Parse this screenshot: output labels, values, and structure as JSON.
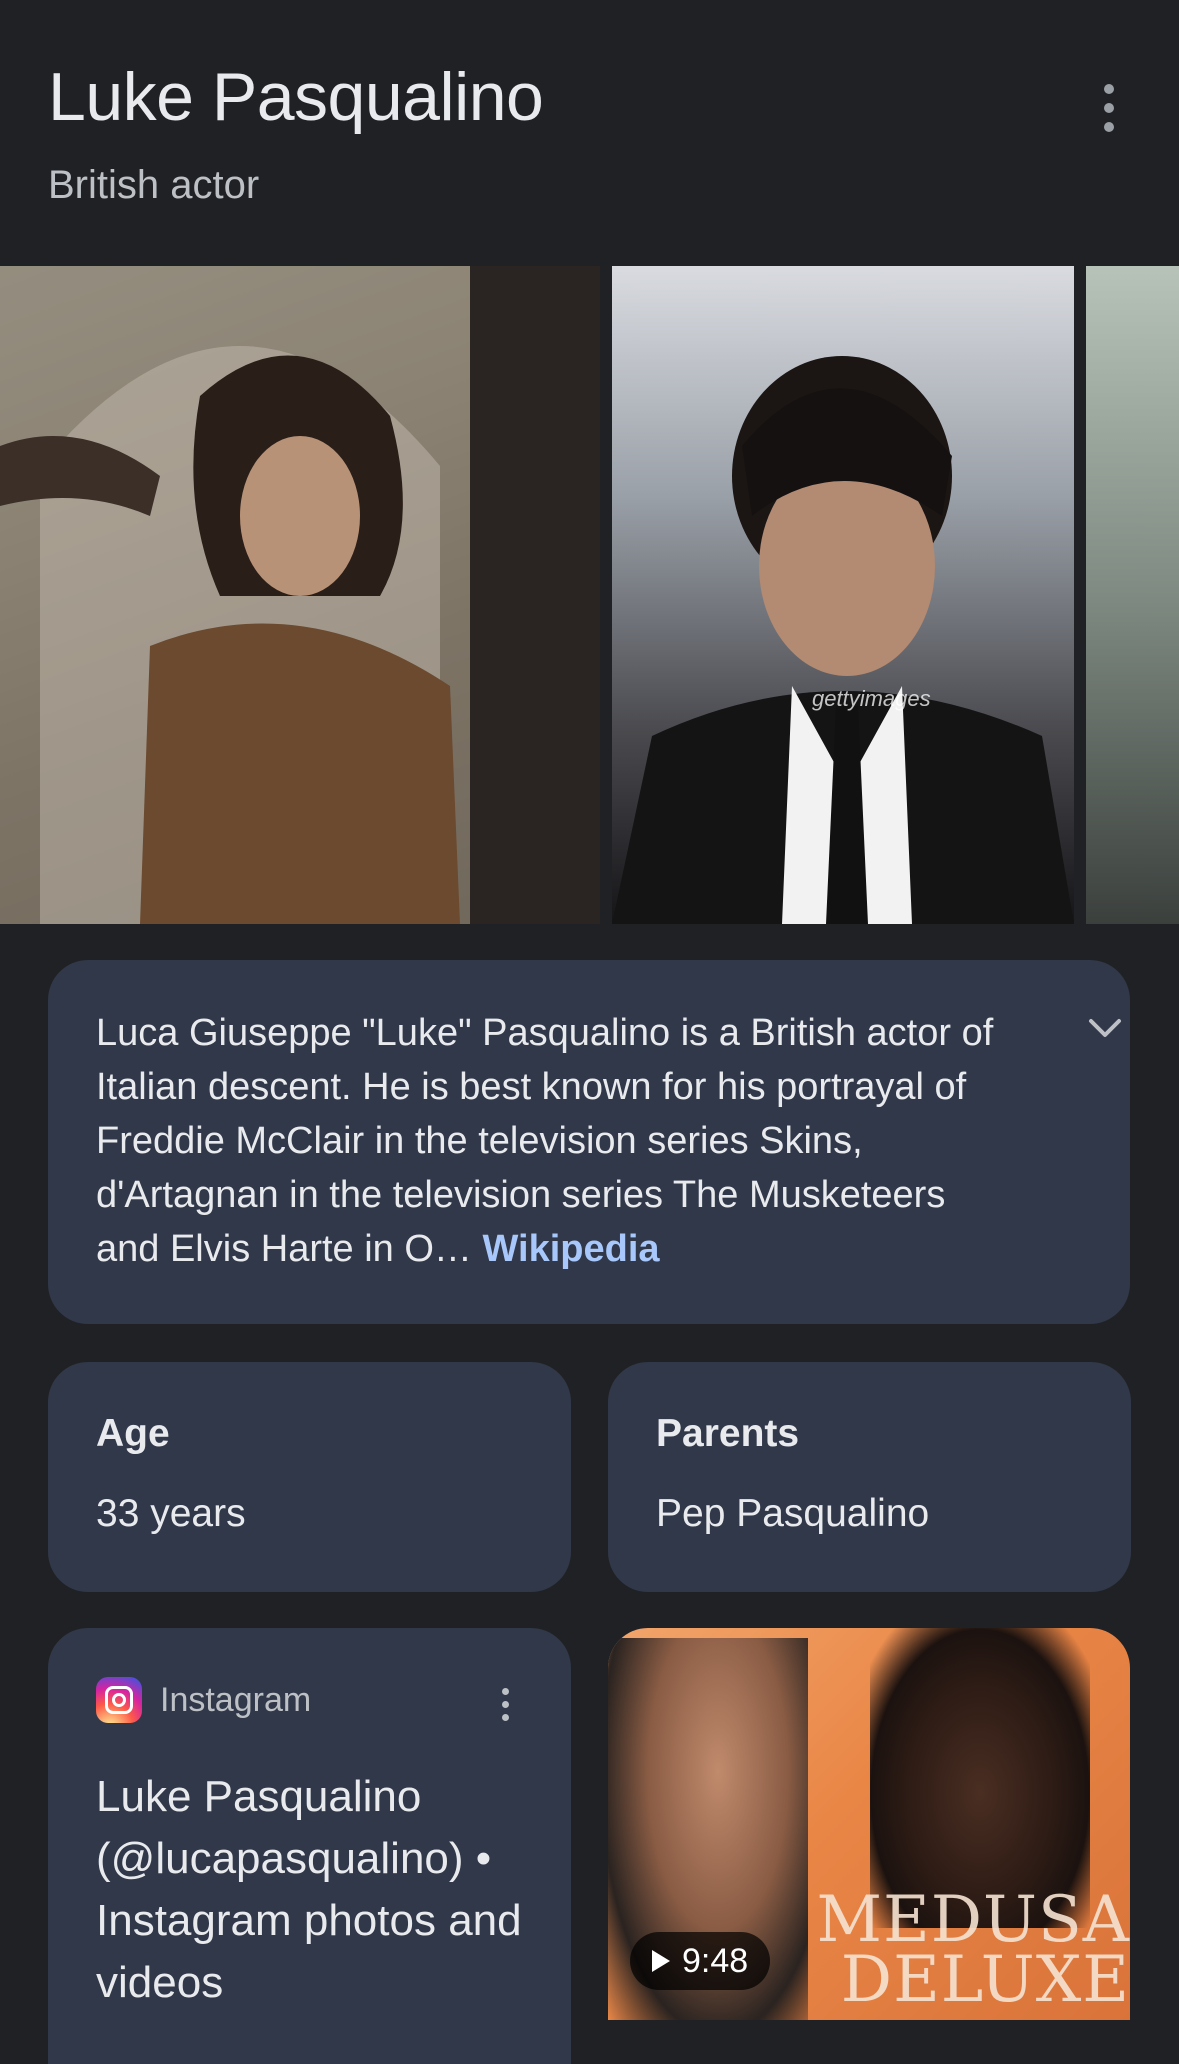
{
  "header": {
    "title": "Luke Pasqualino",
    "subtitle": "British actor",
    "more_icon": "more-vert-icon"
  },
  "images": [
    {
      "name": "photo-musketeer"
    },
    {
      "name": "photo-premiere",
      "watermark": "gettyimages"
    },
    {
      "name": "photo-third"
    }
  ],
  "description": {
    "text": "Luca Giuseppe \"Luke\" Pasqualino is a British actor of Italian descent. He is best known for his portrayal of Freddie McClair in the television series Skins, d'Artagnan in the television series The Musketeers and Elvis Harte in O…",
    "source_link": "Wikipedia",
    "expand_icon": "chevron-down-icon"
  },
  "facts": {
    "age": {
      "label": "Age",
      "value": "33 years"
    },
    "parents": {
      "label": "Parents",
      "value": "Pep Pasqualino"
    }
  },
  "instagram": {
    "source": "Instagram",
    "title": "Luke Pasqualino (@lucapasqualino) • Instagram photos and videos"
  },
  "video": {
    "duration": "9:48",
    "logo_text": "MEDUSA DELUXE"
  },
  "colors": {
    "background": "#202124",
    "card": "#303849",
    "link": "#a8c7fa",
    "text": "#e8eaed"
  }
}
